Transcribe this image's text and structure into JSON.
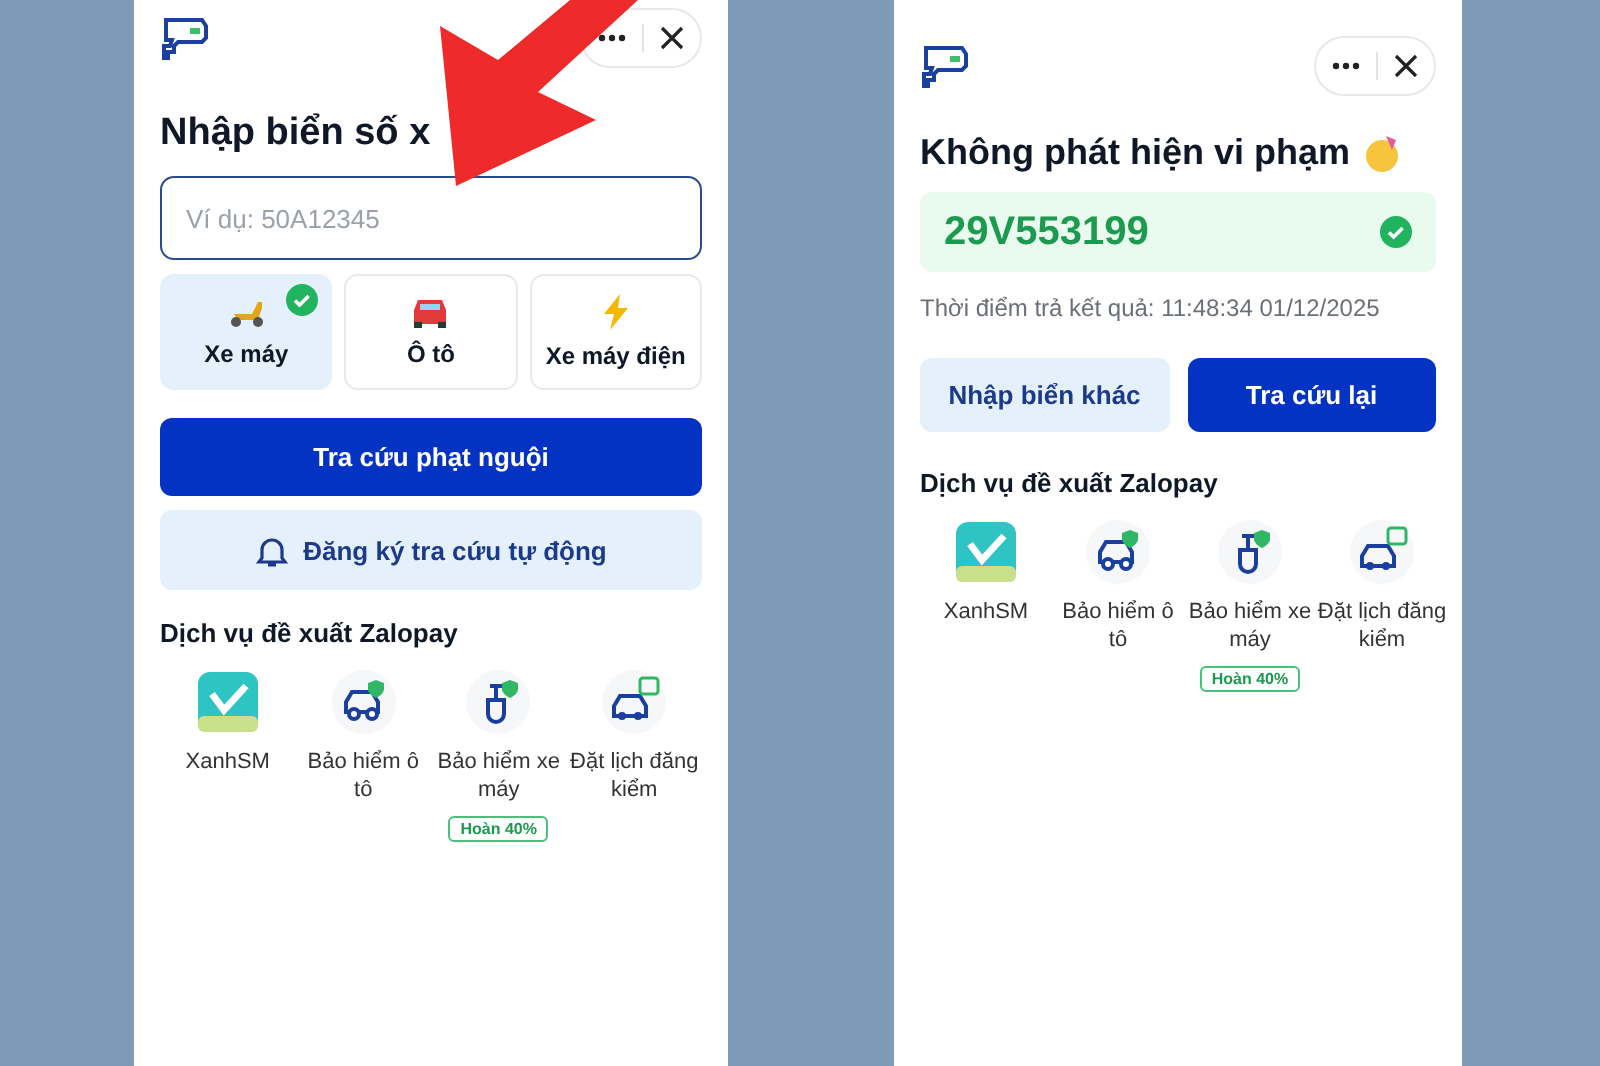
{
  "search_screen": {
    "title": "Nhập biển số x",
    "plate_input": {
      "placeholder": "Ví dụ: 50A12345"
    },
    "vehicle_types": [
      {
        "label": "Xe máy",
        "selected": true
      },
      {
        "label": "Ô tô",
        "selected": false
      },
      {
        "label": "Xe máy điện",
        "selected": false
      }
    ],
    "primary_button": "Tra cứu phạt nguội",
    "secondary_button": "Đăng ký tra cứu tự động",
    "services_title": "Dịch vụ đề xuất Zalopay",
    "services": [
      {
        "label": "XanhSM"
      },
      {
        "label": "Bảo hiểm ô tô"
      },
      {
        "label": "Bảo hiểm xe máy",
        "badge": "Hoàn 40%"
      },
      {
        "label": "Đặt lịch đăng kiểm"
      }
    ]
  },
  "result_screen": {
    "title": "Không phát hiện vi phạm",
    "plate": "29V553199",
    "verified": true,
    "result_time": "Thời điểm trả kết quả: 11:48:34 01/12/2025",
    "buttons": [
      {
        "label": "Nhập biển khác",
        "kind": "secondary"
      },
      {
        "label": "Tra cứu lại",
        "kind": "primary"
      }
    ],
    "services_title": "Dịch vụ đề xuất Zalopay",
    "services": [
      {
        "label": "XanhSM"
      },
      {
        "label": "Bảo hiểm ô tô"
      },
      {
        "label": "Bảo hiểm xe máy",
        "badge": "Hoàn 40%"
      },
      {
        "label": "Đặt lịch đăng kiểm"
      }
    ]
  }
}
